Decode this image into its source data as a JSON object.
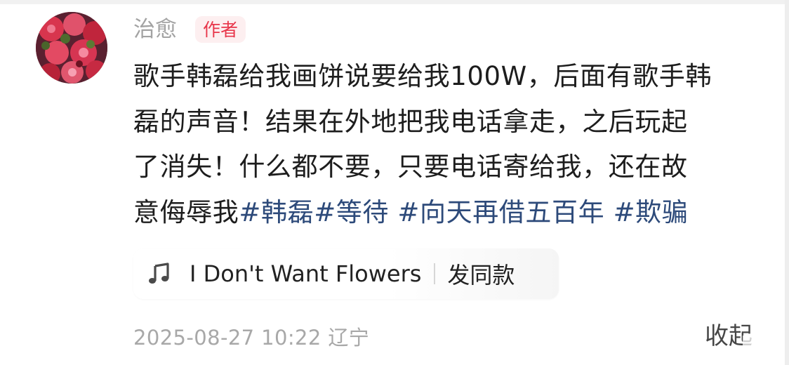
{
  "comment": {
    "author": {
      "name": "治愈",
      "badge": "作者"
    },
    "content": {
      "lines": [
        "歌手韩磊给我画饼说要给我100W，后面有歌手韩",
        "磊的声音！结果在外地把我电话拿走，之后玩起",
        "了消失！什么都不要，只要电话寄给我，还在故"
      ],
      "last_line_text": "意侮辱我",
      "tags": [
        "#韩磊",
        "#等待",
        " #向天再借五百年",
        " #欺骗"
      ]
    },
    "music": {
      "icon": "music-note-icon",
      "title": "I Don't Want Flowers",
      "action": "发同款"
    },
    "meta": {
      "date": "2025-08-27 10:22",
      "location": "辽宁"
    },
    "collapse_label": "收起"
  },
  "colors": {
    "tag": "#2d4a7a",
    "badge_text": "#e8364a",
    "badge_bg": "#fdeff0",
    "meta_text": "#a8a8a8"
  }
}
